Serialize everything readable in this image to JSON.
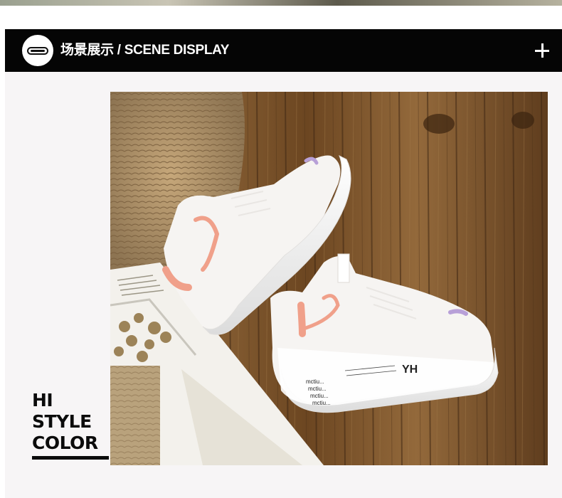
{
  "header": {
    "title": "场景展示 / SCENE DISPLAY",
    "logo_icon": "pill-logo-icon",
    "expand_icon": "plus-icon"
  },
  "overlay_text": {
    "line1": "HI",
    "line2": "STYLE",
    "line3": "COLOR"
  },
  "photo": {
    "subject": "white sneakers with pink accents on wooden floor",
    "sole_print": "YH",
    "sole_text": [
      "mctiu...",
      "mctiu...",
      "mctiu...",
      "mctiu..."
    ]
  },
  "colors": {
    "header_bg": "#050505",
    "header_text": "#ffffff",
    "panel_bg": "#f7f5f6",
    "accent_pink": "#f0a08a",
    "accent_lilac": "#b8a0d8"
  }
}
